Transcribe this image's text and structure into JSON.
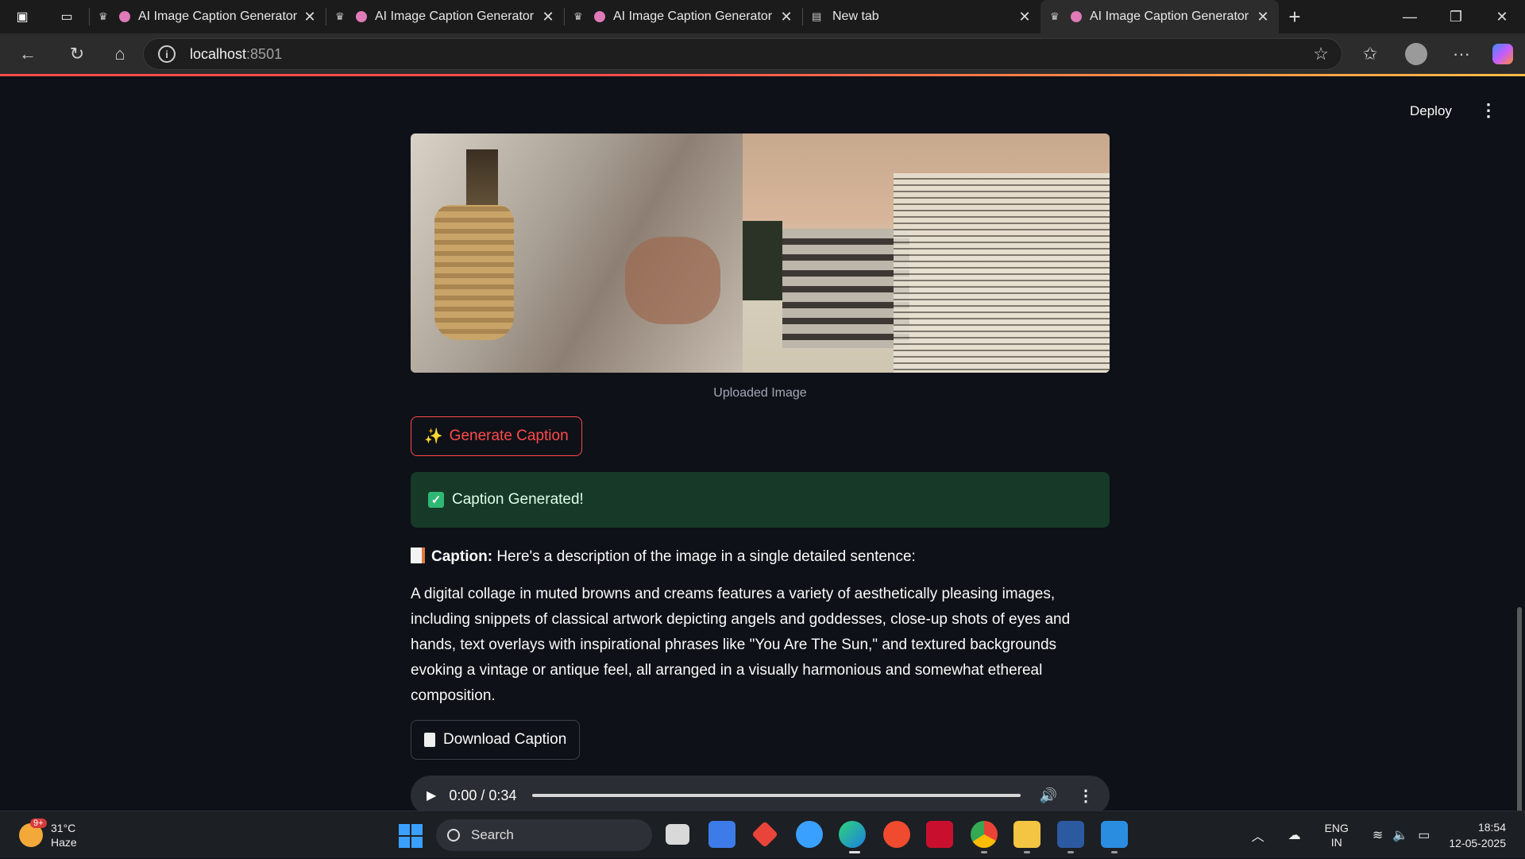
{
  "browser": {
    "tabs": [
      {
        "title": "AI Image Caption Generator",
        "active": false
      },
      {
        "title": "AI Image Caption Generator",
        "active": false
      },
      {
        "title": "AI Image Caption Generator",
        "active": false
      },
      {
        "title": "New tab",
        "active": false
      },
      {
        "title": "AI Image Caption Generator",
        "active": true
      }
    ],
    "address_host": "localhost",
    "address_port": ":8501"
  },
  "app": {
    "deploy_label": "Deploy",
    "image_caption": "Uploaded Image",
    "generate_button": "Generate Caption",
    "success_message": "Caption Generated!",
    "caption_label": "Caption:",
    "caption_intro": "Here's a description of the image in a single detailed sentence:",
    "caption_text": "A digital collage in muted browns and creams features a variety of aesthetically pleasing images, including snippets of classical artwork depicting angels and goddesses, close-up shots of eyes and hands, text overlays with inspirational phrases like \"You Are The Sun,\" and textured backgrounds evoking a vintage or antique feel, all arranged in a visually harmonious and somewhat ethereal composition.",
    "download_button": "Download Caption",
    "audio_time": "0:00 / 0:34"
  },
  "taskbar": {
    "weather_temp": "31°C",
    "weather_cond": "Haze",
    "weather_badge": "9+",
    "search_label": "Search",
    "lang_top": "ENG",
    "lang_bottom": "IN",
    "time": "18:54",
    "date": "12-05-2025"
  }
}
